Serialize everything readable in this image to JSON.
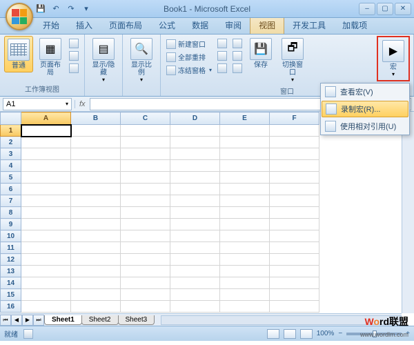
{
  "title": "Book1 - Microsoft Excel",
  "tabs": [
    "开始",
    "插入",
    "页面布局",
    "公式",
    "数据",
    "审阅",
    "视图",
    "开发工具",
    "加载项"
  ],
  "activeTab": "视图",
  "ribbon": {
    "views": {
      "normal": "普通",
      "pageLayout": "页面布局",
      "group": "工作簿视图"
    },
    "showHide": {
      "label": "显示/隐藏"
    },
    "zoom": {
      "label": "显示比例"
    },
    "window": {
      "new": "新建窗口",
      "arrange": "全部重排",
      "freeze": "冻结窗格",
      "save": "保存",
      "switch": "切换窗口",
      "group": "窗口"
    },
    "macro": {
      "label": "宏"
    }
  },
  "macroMenu": {
    "view": "查看宏(V)",
    "record": "录制宏(R)...",
    "relative": "使用相对引用(U)"
  },
  "nameBox": "A1",
  "columns": [
    "A",
    "B",
    "C",
    "D",
    "E",
    "F"
  ],
  "rows": [
    1,
    2,
    3,
    4,
    5,
    6,
    7,
    8,
    9,
    10,
    11,
    12,
    13,
    14,
    15,
    16
  ],
  "selectedCell": "A1",
  "sheets": [
    "Sheet1",
    "Sheet2",
    "Sheet3"
  ],
  "status": {
    "ready": "就绪",
    "zoom": "100%"
  },
  "watermark": {
    "t1": "W",
    "t2": "o",
    "t3": "rd联盟",
    "url": "www.wordlm.com"
  }
}
